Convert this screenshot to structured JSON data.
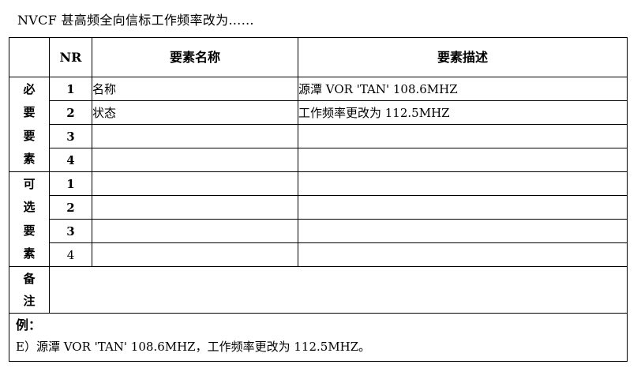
{
  "title": "NVCF  甚高频全向信标工作频率改为……",
  "table": {
    "headers": {
      "nr": "NR",
      "name": "要素名称",
      "desc": "要素描述"
    },
    "required": {
      "label": [
        "必",
        "要",
        "要",
        "素"
      ],
      "rows": [
        {
          "nr": "1",
          "name": "名称",
          "desc": "源潭 VOR 'TAN' 108.6MHZ"
        },
        {
          "nr": "2",
          "name": "状态",
          "desc": "工作频率更改为 112.5MHZ"
        },
        {
          "nr": "3",
          "name": "",
          "desc": ""
        },
        {
          "nr": "4",
          "name": "",
          "desc": ""
        }
      ]
    },
    "optional": {
      "label": [
        "可",
        "选",
        "要",
        "素"
      ],
      "rows": [
        {
          "nr": "1",
          "name": "",
          "desc": ""
        },
        {
          "nr": "2",
          "name": "",
          "desc": ""
        },
        {
          "nr": "3",
          "name": "",
          "desc": ""
        },
        {
          "nr": "4",
          "name": "",
          "desc": ""
        }
      ]
    },
    "remarks": {
      "label": [
        "备",
        "注"
      ],
      "text": ""
    },
    "example": {
      "label": "例：",
      "text": "E）源潭 VOR 'TAN' 108.6MHZ，工作频率更改为 112.5MHZ。"
    }
  }
}
